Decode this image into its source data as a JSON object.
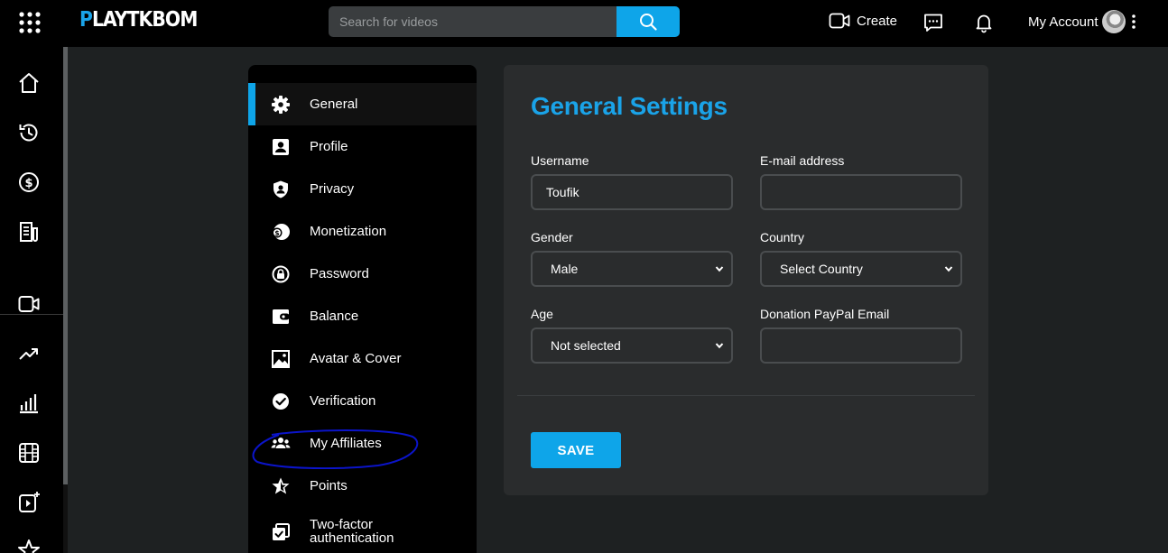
{
  "header": {
    "logo_first": "P",
    "logo_rest": "LAYTKBOM",
    "search_placeholder": "Search for videos",
    "create_label": "Create",
    "account_label": "My Account"
  },
  "settings_nav": {
    "items": [
      {
        "label": "General",
        "icon": "gear-icon",
        "active": true
      },
      {
        "label": "Profile",
        "icon": "profile-icon"
      },
      {
        "label": "Privacy",
        "icon": "shield-icon"
      },
      {
        "label": "Monetization",
        "icon": "monetization-icon"
      },
      {
        "label": "Password",
        "icon": "lock-icon"
      },
      {
        "label": "Balance",
        "icon": "wallet-icon"
      },
      {
        "label": "Avatar & Cover",
        "icon": "image-icon"
      },
      {
        "label": "Verification",
        "icon": "check-circle-icon"
      },
      {
        "label": "My Affiliates",
        "icon": "users-icon"
      },
      {
        "label": "Points",
        "icon": "star-icon"
      },
      {
        "label_line1": "Two-factor",
        "label_line2": "authentication",
        "icon": "two-factor-icon"
      }
    ]
  },
  "form": {
    "title": "General Settings",
    "username_label": "Username",
    "username_value": "Toufik",
    "email_label": "E-mail address",
    "email_value": "",
    "gender_label": "Gender",
    "gender_value": "Male",
    "country_label": "Country",
    "country_value": "Select Country",
    "age_label": "Age",
    "age_value": "Not selected",
    "paypal_label": "Donation PayPal Email",
    "paypal_value": "",
    "save_label": "SAVE"
  },
  "colors": {
    "accent": "#0ea5e9",
    "title": "#1aa3e8",
    "annotation": "#0b14c9"
  }
}
